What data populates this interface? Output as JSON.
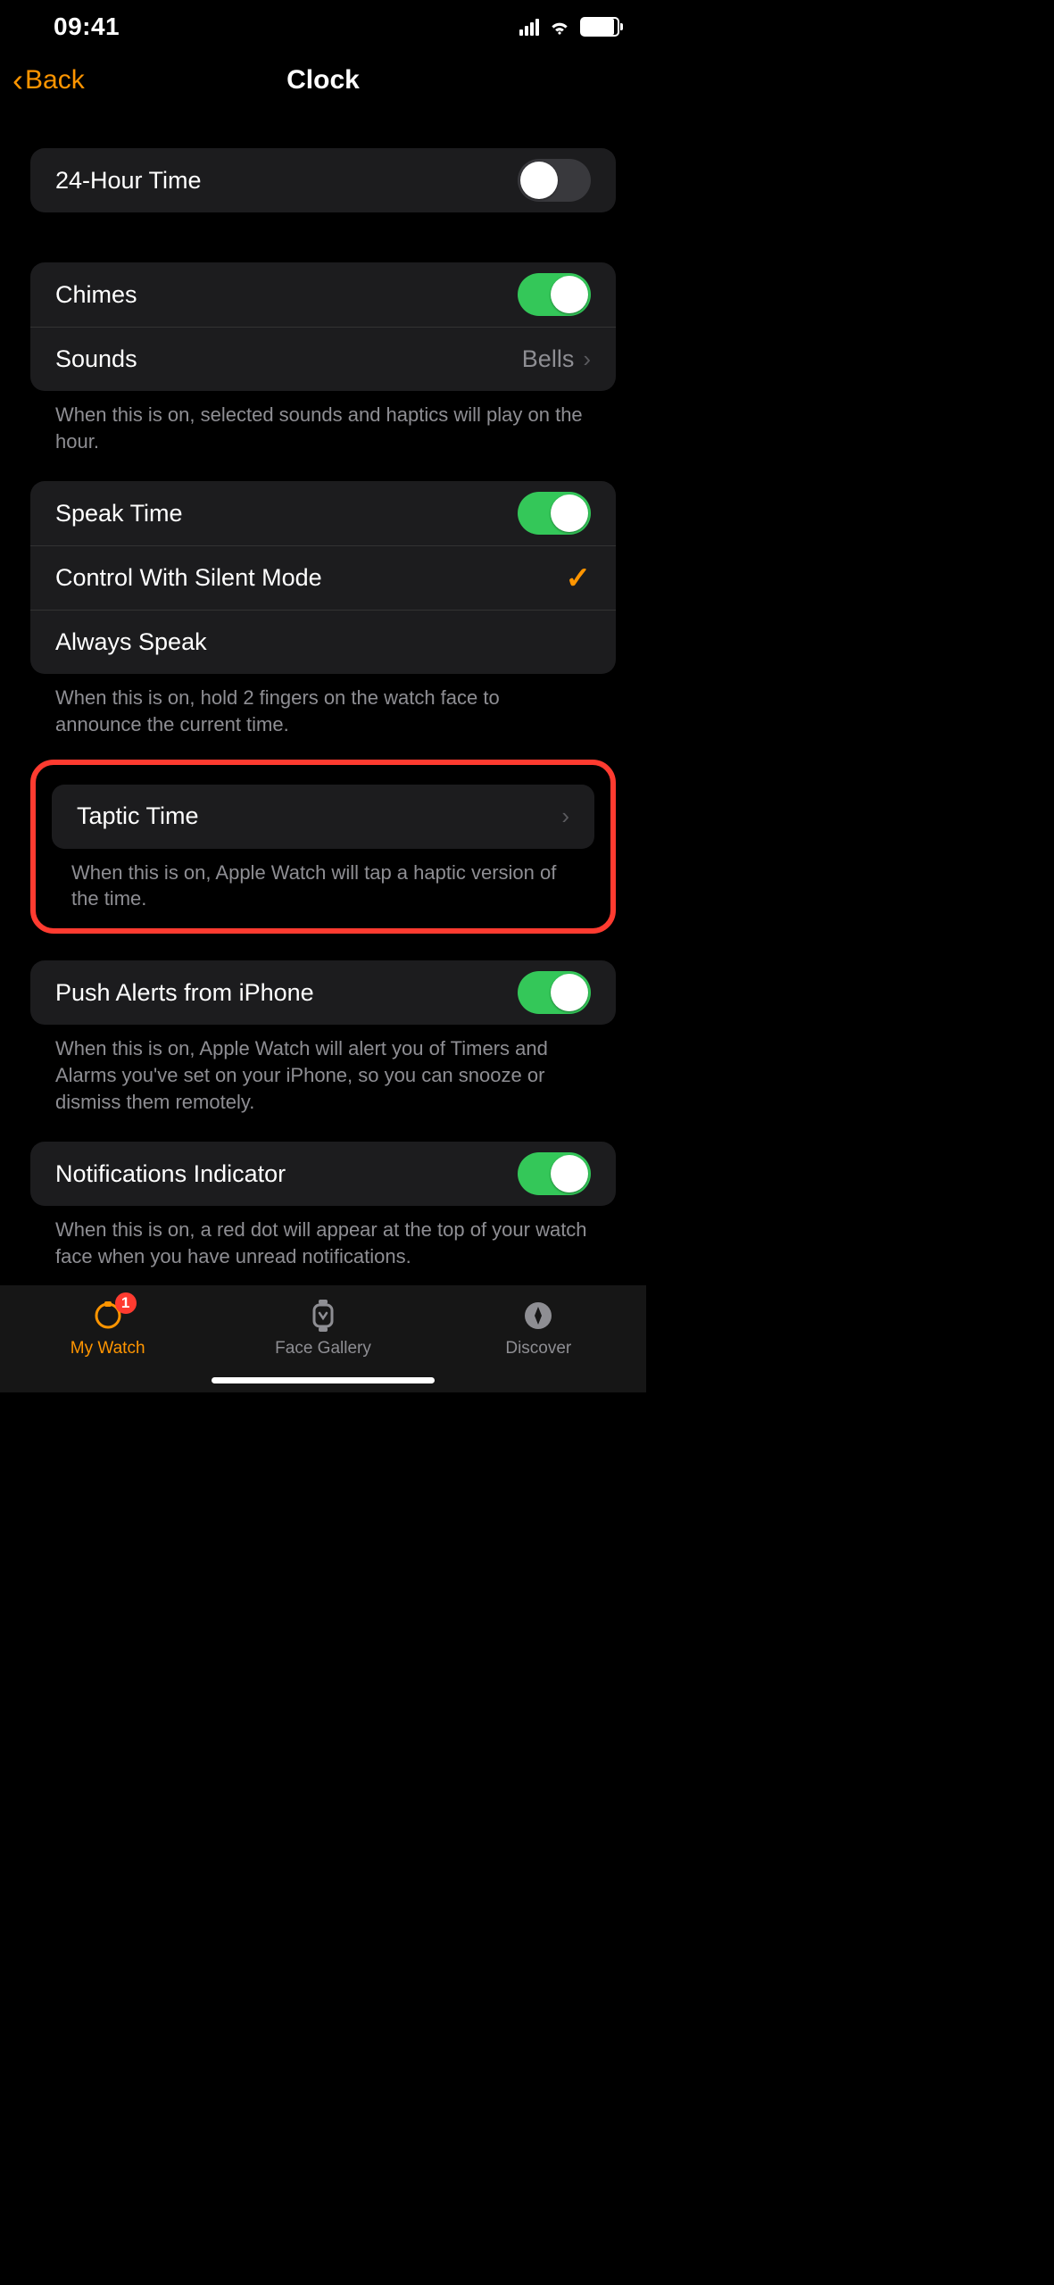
{
  "status": {
    "time": "09:41"
  },
  "nav": {
    "back": "Back",
    "title": "Clock"
  },
  "s24h": {
    "label": "24-Hour Time",
    "on": false
  },
  "chimes": {
    "chimes_label": "Chimes",
    "chimes_on": true,
    "sounds_label": "Sounds",
    "sounds_value": "Bells",
    "footer": "When this is on, selected sounds and haptics will play on the hour."
  },
  "speak": {
    "speak_label": "Speak Time",
    "speak_on": true,
    "control_label": "Control With Silent Mode",
    "control_checked": true,
    "always_label": "Always Speak",
    "footer": "When this is on, hold 2 fingers on the watch face to announce the current time."
  },
  "taptic": {
    "label": "Taptic Time",
    "footer": "When this is on, Apple Watch will tap a haptic version of the time."
  },
  "push": {
    "label": "Push Alerts from iPhone",
    "on": true,
    "footer": "When this is on, Apple Watch will alert you of Timers and Alarms you've set on your iPhone, so you can snooze or dismiss them remotely."
  },
  "notif": {
    "label": "Notifications Indicator",
    "on": true,
    "footer": "When this is on, a red dot will appear at the top of your watch face when you have unread notifications."
  },
  "tabs": {
    "watch": "My Watch",
    "badge": "1",
    "gallery": "Face Gallery",
    "discover": "Discover"
  }
}
